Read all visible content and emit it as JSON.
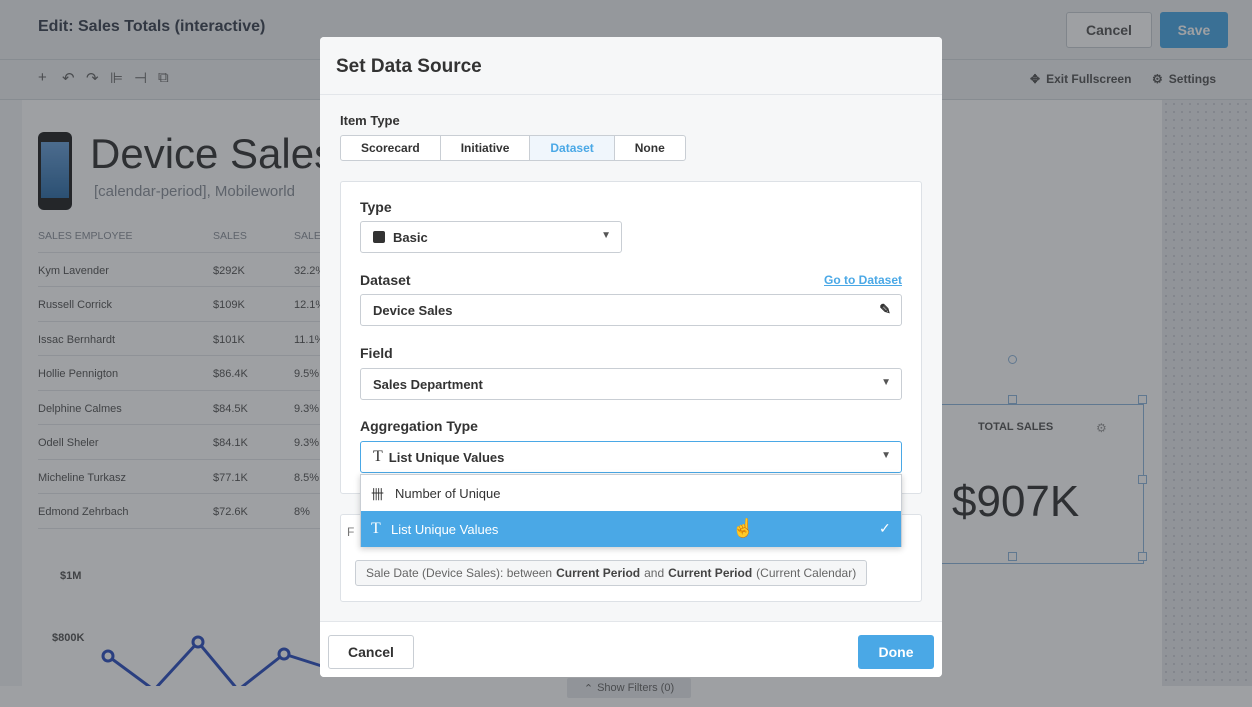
{
  "editor": {
    "title": "Edit: Sales Totals (interactive)",
    "cancel_label": "Cancel",
    "save_label": "Save",
    "exit_fullscreen_label": "Exit Fullscreen",
    "settings_label": "Settings",
    "show_filters_label": "Show Filters (0)"
  },
  "background": {
    "header_title": "Device Sales",
    "header_subtitle": "[calendar-period], Mobileworld",
    "table": {
      "columns": [
        "SALES EMPLOYEE",
        "SALES",
        "SALE"
      ],
      "rows": [
        [
          "Kym Lavender",
          "$292K",
          "32.2%"
        ],
        [
          "Russell Corrick",
          "$109K",
          "12.1%"
        ],
        [
          "Issac Bernhardt",
          "$101K",
          "11.1%"
        ],
        [
          "Hollie Pennigton",
          "$86.4K",
          "9.5%"
        ],
        [
          "Delphine Calmes",
          "$84.5K",
          "9.3%"
        ],
        [
          "Odell Sheler",
          "$84.1K",
          "9.3%"
        ],
        [
          "Micheline Turkasz",
          "$77.1K",
          "8.5%"
        ],
        [
          "Edmond Zehrbach",
          "$72.6K",
          "8%"
        ]
      ]
    },
    "total_sales": {
      "label": "TOTAL SALES",
      "value": "$907K"
    },
    "chart": {
      "y1": "$1M",
      "y2": "$800K"
    }
  },
  "modal": {
    "title": "Set Data Source",
    "item_type_label": "Item Type",
    "item_types": [
      "Scorecard",
      "Initiative",
      "Dataset",
      "None"
    ],
    "active_item_type": "Dataset",
    "type_label": "Type",
    "type_value": "Basic",
    "dataset_label": "Dataset",
    "goto_dataset": "Go to Dataset",
    "dataset_value": "Device Sales",
    "field_label": "Field",
    "field_value": "Sales Department",
    "aggregation_label": "Aggregation Type",
    "aggregation_value": "List Unique Values",
    "aggregation_options": [
      {
        "icon": "tally-icon",
        "glyph": "卌",
        "label": "Number of Unique",
        "selected": false
      },
      {
        "icon": "text-t-icon",
        "glyph": "T",
        "label": "List Unique Values",
        "selected": true
      }
    ],
    "filter": {
      "prefix": "Sale Date (Device Sales): between",
      "from": "Current Period",
      "and": "and",
      "to": "Current Period",
      "suffix": "(Current Calendar)"
    },
    "cancel_label": "Cancel",
    "done_label": "Done"
  }
}
